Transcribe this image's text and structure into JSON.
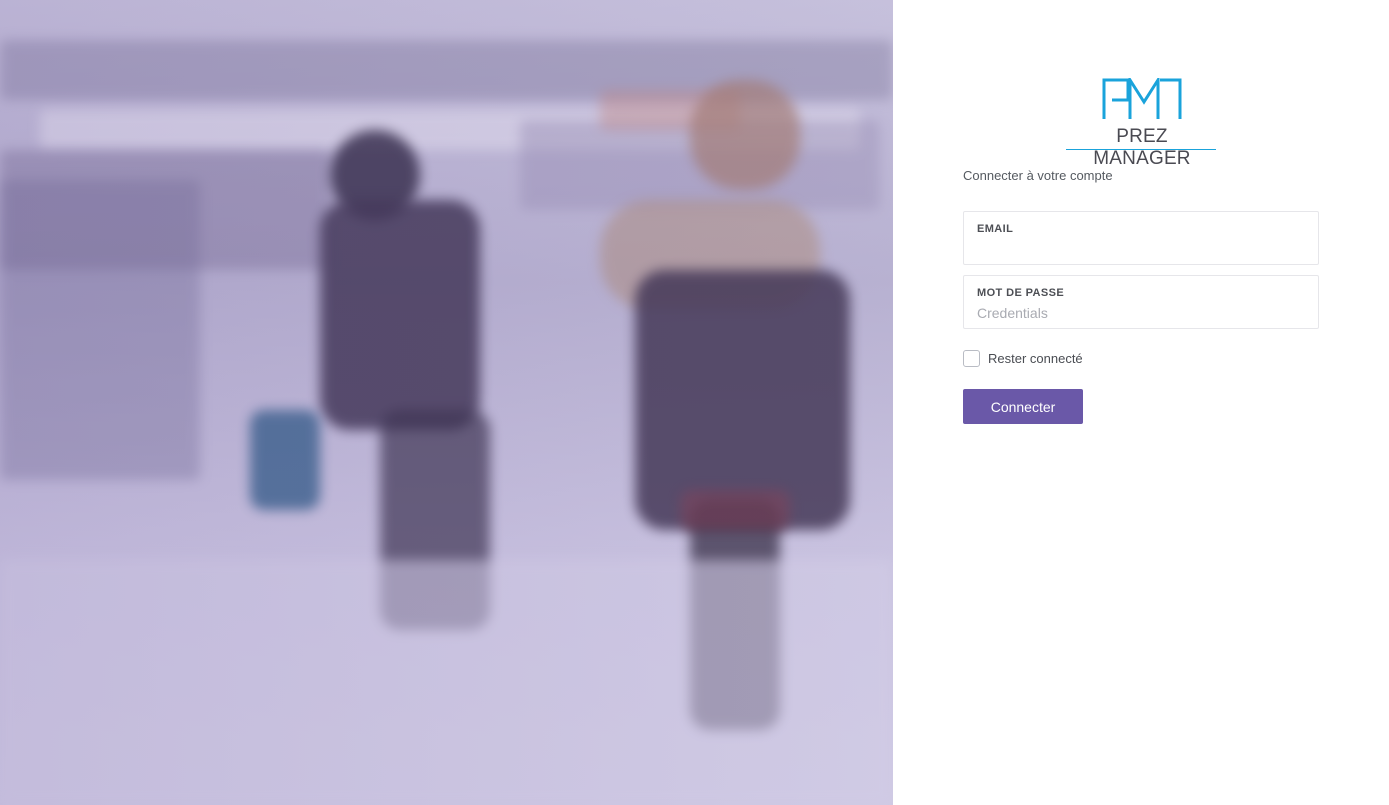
{
  "brand": {
    "name": "PREZ MANAGER",
    "accent_color": "#1aa3db"
  },
  "login": {
    "subtitle": "Connecter à votre compte",
    "email_label": "EMAIL",
    "email_value": "",
    "password_label": "MOT DE PASSE",
    "password_placeholder": "Credentials",
    "remember_label": "Rester connecté",
    "remember_checked": false,
    "submit_label": "Connecter",
    "button_color": "#6a58a8"
  }
}
